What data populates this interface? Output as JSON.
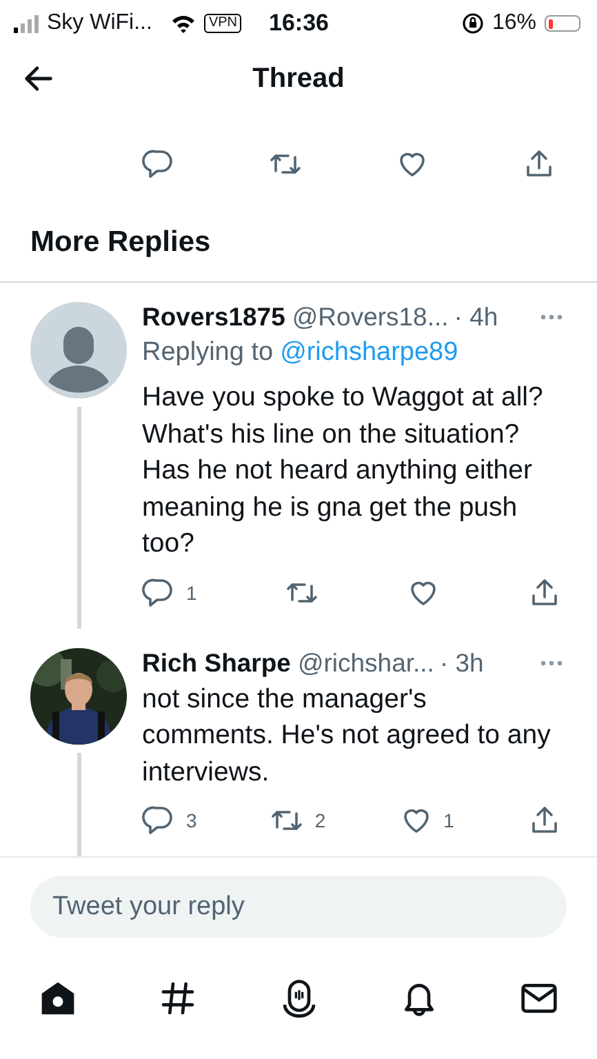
{
  "status_bar": {
    "carrier": "Sky WiFi...",
    "vpn": "VPN",
    "time": "16:36",
    "battery": "16%"
  },
  "header": {
    "title": "Thread"
  },
  "previous_tweet_actions": [
    {
      "kind": "reply"
    },
    {
      "kind": "retweet"
    },
    {
      "kind": "like"
    },
    {
      "kind": "share"
    }
  ],
  "section_title": "More Replies",
  "replies": [
    {
      "avatar": {
        "kind": "default"
      },
      "name": "Rovers1875",
      "handle": "@Rovers18...",
      "time": "· 4h",
      "replying_to": {
        "label": "Replying to",
        "handle": "@richsharpe89"
      },
      "text": "Have you spoke to Waggot at all? What's his line on the situation? Has he not heard anything either meaning he is gna get the push too?",
      "actions": [
        {
          "kind": "reply",
          "count": "1"
        },
        {
          "kind": "retweet"
        },
        {
          "kind": "like"
        },
        {
          "kind": "share"
        }
      ]
    },
    {
      "avatar": {
        "kind": "picture"
      },
      "name": "Rich Sharpe",
      "handle": "@richshar...",
      "time": "· 3h",
      "text": "not since the manager's comments. He's not agreed to any interviews.",
      "actions": [
        {
          "kind": "reply",
          "count": "3"
        },
        {
          "kind": "retweet",
          "count": "2"
        },
        {
          "kind": "like",
          "count": "1"
        },
        {
          "kind": "share"
        }
      ]
    }
  ],
  "reply_field": {
    "placeholder": "Tweet your reply"
  },
  "tabs": [
    {
      "kind": "home",
      "selected": true
    },
    {
      "kind": "explore",
      "selected": false
    },
    {
      "kind": "spaces",
      "selected": false
    },
    {
      "kind": "notifications",
      "selected": false
    },
    {
      "kind": "messages",
      "selected": false
    }
  ]
}
